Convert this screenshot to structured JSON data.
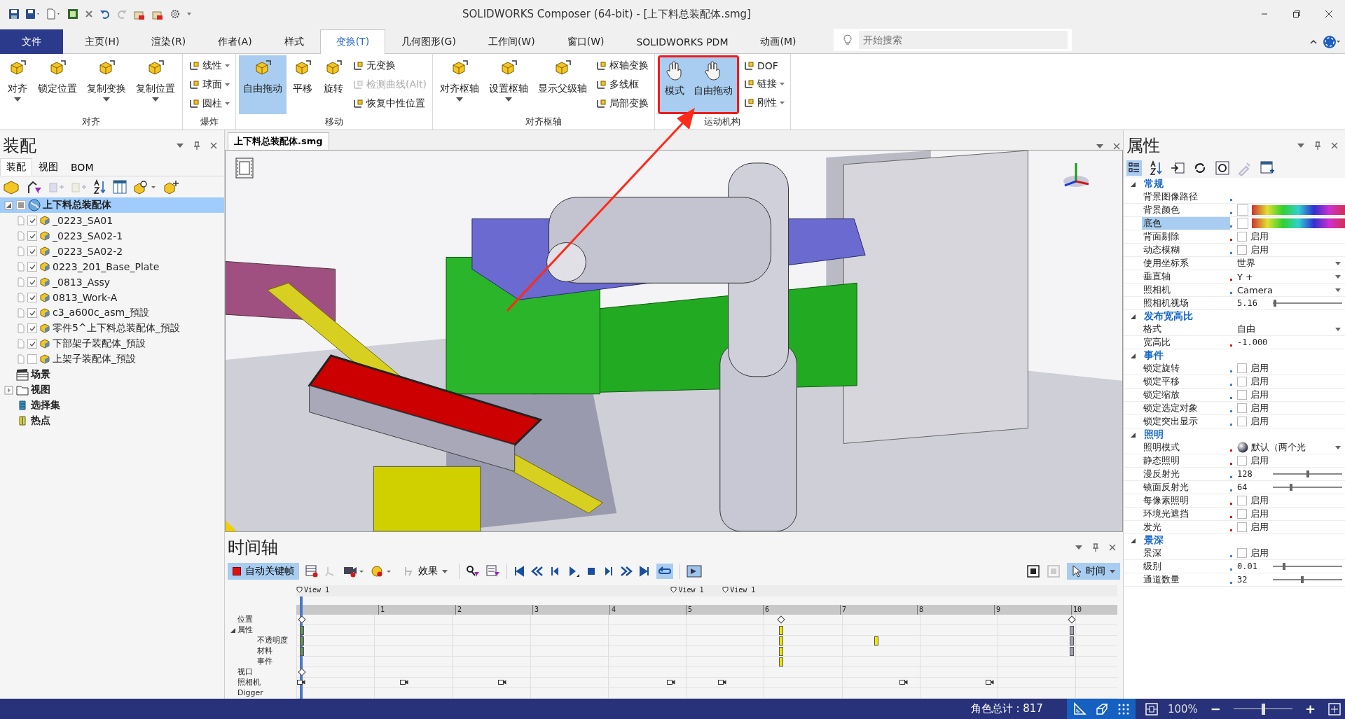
{
  "window": {
    "title": "SOLIDWORKS Composer (64-bit) - [上下料总装配体.smg]"
  },
  "menu_tabs": [
    {
      "label": "文件",
      "kind": "file",
      "selected": false
    },
    {
      "label": "主页(H)",
      "kind": "tab",
      "selected": false
    },
    {
      "label": "渲染(R)",
      "kind": "tab",
      "selected": false
    },
    {
      "label": "作者(A)",
      "kind": "tab",
      "selected": false
    },
    {
      "label": "样式",
      "kind": "tab",
      "selected": false
    },
    {
      "label": "变换(T)",
      "kind": "tab",
      "selected": true
    },
    {
      "label": "几何图形(G)",
      "kind": "tab",
      "selected": false
    },
    {
      "label": "工作间(W)",
      "kind": "tab",
      "selected": false
    },
    {
      "label": "窗口(W)",
      "kind": "tab",
      "selected": false
    },
    {
      "label": "SOLIDWORKS PDM",
      "kind": "tab",
      "selected": false
    },
    {
      "label": "动画(M)",
      "kind": "tab",
      "selected": false
    }
  ],
  "search": {
    "placeholder": "开始搜索"
  },
  "ribbon": {
    "groups": [
      {
        "title": "对齐",
        "columns": [
          {
            "kind": "large",
            "label": "对齐",
            "dropdown": true,
            "selected": false
          },
          {
            "kind": "large",
            "label": "锁定位置",
            "dropdown": false,
            "selected": false
          },
          {
            "kind": "large",
            "label": "复制变换",
            "dropdown": true,
            "selected": false
          },
          {
            "kind": "large",
            "label": "复制位置",
            "dropdown": true,
            "selected": false
          }
        ]
      },
      {
        "title": "爆炸",
        "columns": [
          {
            "kind": "stack",
            "items": [
              {
                "label": "线性",
                "dropdown": true,
                "disabled": false
              },
              {
                "label": "球面",
                "dropdown": true,
                "disabled": false
              },
              {
                "label": "圆柱",
                "dropdown": true,
                "disabled": false
              }
            ]
          }
        ]
      },
      {
        "title": "移动",
        "columns": [
          {
            "kind": "large",
            "label": "自由拖动",
            "dropdown": false,
            "selected": true
          },
          {
            "kind": "large",
            "label": "平移",
            "dropdown": false,
            "selected": false
          },
          {
            "kind": "large",
            "label": "旋转",
            "dropdown": false,
            "selected": false
          },
          {
            "kind": "stack",
            "items": [
              {
                "label": "无变换",
                "dropdown": false,
                "disabled": false
              },
              {
                "label": "检测曲线(Alt)",
                "dropdown": false,
                "disabled": true
              },
              {
                "label": "恢复中性位置",
                "dropdown": false,
                "disabled": false
              }
            ]
          }
        ]
      },
      {
        "title": "对齐枢轴",
        "columns": [
          {
            "kind": "large",
            "label": "对齐枢轴",
            "dropdown": true,
            "selected": false
          },
          {
            "kind": "large",
            "label": "设置枢轴",
            "dropdown": true,
            "selected": false
          },
          {
            "kind": "large",
            "label": "显示父级轴",
            "dropdown": false,
            "selected": false
          },
          {
            "kind": "stack",
            "items": [
              {
                "label": "枢轴变换",
                "dropdown": false,
                "disabled": false
              },
              {
                "label": "多线框",
                "dropdown": false,
                "disabled": false
              },
              {
                "label": "局部变换",
                "dropdown": false,
                "disabled": false
              }
            ]
          }
        ]
      },
      {
        "title": "运动机构",
        "columns": [
          {
            "kind": "frame",
            "items": [
              {
                "label": "模式",
                "dropdown": false,
                "selected": true
              },
              {
                "label": "自由拖动",
                "dropdown": false,
                "selected": true
              }
            ]
          },
          {
            "kind": "stack",
            "items": [
              {
                "label": "DOF",
                "dropdown": false,
                "disabled": false
              },
              {
                "label": "链接",
                "dropdown": true,
                "disabled": false
              },
              {
                "label": "刚性",
                "dropdown": true,
                "disabled": false
              }
            ]
          }
        ]
      }
    ]
  },
  "assembly_panel": {
    "title": "装配",
    "tabs": [
      {
        "label": "装配",
        "selected": true
      },
      {
        "label": "视图",
        "selected": false
      },
      {
        "label": "BOM",
        "selected": false
      }
    ],
    "tree": [
      {
        "label": "上下料总装配体",
        "kind": "assembly",
        "selected": true,
        "expanded": true,
        "partial": true,
        "children": [
          {
            "label": "_0223_SA01",
            "checked": true,
            "selected": false
          },
          {
            "label": "_0223_SA02-1",
            "checked": true,
            "selected": false
          },
          {
            "label": "_0223_SA02-2",
            "checked": true,
            "selected": false
          },
          {
            "label": "0223_201_Base_Plate",
            "checked": true,
            "selected": false
          },
          {
            "label": "_0813_Assy",
            "checked": true,
            "selected": false
          },
          {
            "label": "0813_Work-A",
            "checked": true,
            "selected": false
          },
          {
            "label": "c3_a600c_asm_預設",
            "checked": true,
            "selected": false
          },
          {
            "label": "零件5^上下料总装配体_預設",
            "checked": true,
            "selected": false
          },
          {
            "label": "下部架子装配体_預設",
            "checked": true,
            "selected": false
          },
          {
            "label": "上架子装配体_預設",
            "checked": false,
            "selected": false
          }
        ]
      },
      {
        "label": "场景",
        "kind": "scene",
        "selected": false
      },
      {
        "label": "视图",
        "kind": "folder",
        "selected": false
      },
      {
        "label": "选择集",
        "kind": "selection",
        "selected": false
      },
      {
        "label": "热点",
        "kind": "hotspot",
        "selected": false
      }
    ]
  },
  "document_tab": {
    "label": "上下料总装配体.smg"
  },
  "timeline": {
    "title": "时间轴",
    "autokey": {
      "label": "自动关键帧",
      "selected": true
    },
    "effects": {
      "label": "效果"
    },
    "loop": {
      "selected": true
    },
    "mode": {
      "label": "时间",
      "selected": true
    },
    "view_markers": [
      {
        "label": "View 1",
        "level": 0
      },
      {
        "label": "View 1",
        "level": 0.456
      },
      {
        "label": "View 1",
        "level": 0.519
      }
    ],
    "ticks": [
      {
        "label": "1",
        "level": 0.095
      },
      {
        "label": "2",
        "level": 0.19
      },
      {
        "label": "3",
        "level": 0.285
      },
      {
        "label": "4",
        "level": 0.38
      },
      {
        "label": "5",
        "level": 0.474
      },
      {
        "label": "6",
        "level": 0.569
      },
      {
        "label": "7",
        "level": 0.664
      },
      {
        "label": "8",
        "level": 0.759
      },
      {
        "label": "9",
        "level": 0.854
      },
      {
        "label": "10",
        "level": 0.949
      }
    ],
    "playhead": {
      "level": 0
    },
    "tracks": [
      {
        "label": "位置",
        "keys": [
          {
            "kind": "diamond",
            "level": 0
          },
          {
            "kind": "diamond",
            "level": 0.591
          },
          {
            "kind": "diamond",
            "level": 0.949
          }
        ]
      },
      {
        "label": "属性",
        "expanded": true,
        "keys": [
          {
            "kind": "bar",
            "color": "#5f9360",
            "level": 0
          },
          {
            "kind": "bar",
            "color": "#f2e600",
            "level": 0.591
          },
          {
            "kind": "bar",
            "color": "#a0a4b0",
            "level": 0.949
          }
        ],
        "children": [
          {
            "label": "不透明度",
            "keys": [
              {
                "kind": "bar",
                "color": "#5f9360",
                "level": 0
              },
              {
                "kind": "bar",
                "color": "#f2e600",
                "level": 0.591
              },
              {
                "kind": "bar",
                "color": "#f2e600",
                "level": 0.708
              },
              {
                "kind": "bar",
                "color": "#a0a4b0",
                "level": 0.949
              }
            ]
          },
          {
            "label": "材料",
            "keys": [
              {
                "kind": "bar",
                "color": "#5f9360",
                "level": 0
              },
              {
                "kind": "bar",
                "color": "#f2e600",
                "level": 0.591
              },
              {
                "kind": "bar",
                "color": "#a0a4b0",
                "level": 0.949
              }
            ]
          },
          {
            "label": "事件",
            "keys": [
              {
                "kind": "bar",
                "color": "#f2e600",
                "level": 0.591
              }
            ]
          }
        ]
      },
      {
        "label": "视口",
        "keys": [
          {
            "kind": "diamond",
            "level": 0
          }
        ]
      },
      {
        "label": "照相机",
        "keys": [
          {
            "kind": "camera",
            "level": 0
          },
          {
            "kind": "camera",
            "level": 0.127
          },
          {
            "kind": "camera",
            "level": 0.248
          },
          {
            "kind": "camera",
            "level": 0.456
          },
          {
            "kind": "camera",
            "level": 0.519
          },
          {
            "kind": "camera",
            "level": 0.743
          },
          {
            "kind": "camera",
            "level": 0.849
          }
        ]
      },
      {
        "label": "Digger"
      }
    ]
  },
  "properties": {
    "title": "属性",
    "sections": [
      {
        "title": "常规",
        "expanded": true,
        "rows": [
          {
            "name": "背景图像路径",
            "kind": "empty",
            "color": "#3c7fd0",
            "selected": false
          },
          {
            "name": "背景颜色",
            "kind": "color",
            "color": "#3c7fd0",
            "selected": false
          },
          {
            "name": "底色",
            "kind": "color",
            "color": "#3c7fd0",
            "selected": true
          },
          {
            "name": "背面剔除",
            "kind": "checkbox",
            "label": "启用",
            "checked": false,
            "color": "#e01010",
            "selected": false
          },
          {
            "name": "动态模糊",
            "kind": "checkbox",
            "label": "启用",
            "checked": false,
            "color": "#3c7fd0",
            "selected": false
          },
          {
            "name": "使用坐标系",
            "kind": "select",
            "value": "世界",
            "selected": false
          },
          {
            "name": "垂直轴",
            "kind": "select",
            "value": "Y +",
            "color": "#e01010",
            "selected": false
          },
          {
            "name": "照相机",
            "kind": "select",
            "value": "Camera",
            "color": "#3c7fd0",
            "selected": false
          },
          {
            "name": "照相机视场",
            "kind": "slider",
            "value": "5.16",
            "level": 0.03,
            "selected": false
          }
        ]
      },
      {
        "title": "发布宽高比",
        "expanded": true,
        "rows": [
          {
            "name": "格式",
            "kind": "select",
            "value": "自由",
            "selected": false
          },
          {
            "name": "宽高比",
            "kind": "text",
            "value": "-1.000",
            "color": "#e01010",
            "selected": false
          }
        ]
      },
      {
        "title": "事件",
        "expanded": true,
        "rows": [
          {
            "name": "锁定旋转",
            "kind": "checkbox",
            "label": "启用",
            "checked": false,
            "color": "#3c7fd0",
            "selected": false
          },
          {
            "name": "锁定平移",
            "kind": "checkbox",
            "label": "启用",
            "checked": false,
            "color": "#3c7fd0",
            "selected": false
          },
          {
            "name": "锁定缩放",
            "kind": "checkbox",
            "label": "启用",
            "checked": false,
            "color": "#3c7fd0",
            "selected": false
          },
          {
            "name": "锁定选定对象",
            "kind": "checkbox",
            "label": "启用",
            "checked": false,
            "color": "#3c7fd0",
            "selected": false
          },
          {
            "name": "锁定突出显示",
            "kind": "checkbox",
            "label": "启用",
            "checked": false,
            "color": "#3c7fd0",
            "selected": false
          }
        ]
      },
      {
        "title": "照明",
        "expanded": true,
        "rows": [
          {
            "name": "照明模式",
            "kind": "lighting",
            "value": "默认（两个光",
            "color": "#e01010",
            "selected": false
          },
          {
            "name": "静态照明",
            "kind": "checkbox",
            "label": "启用",
            "checked": false,
            "color": "#e01010",
            "selected": false
          },
          {
            "name": "漫反射光",
            "kind": "slider",
            "value": "128",
            "level": 0.5,
            "color": "#3c7fd0",
            "selected": false
          },
          {
            "name": "镜面反射光",
            "kind": "slider",
            "value": "64",
            "level": 0.26,
            "color": "#3c7fd0",
            "selected": false
          },
          {
            "name": "每像素照明",
            "kind": "checkbox",
            "label": "启用",
            "checked": false,
            "color": "#e01010",
            "selected": false
          },
          {
            "name": "环境光遮挡",
            "kind": "checkbox",
            "label": "启用",
            "checked": false,
            "color": "#e01010",
            "selected": false
          },
          {
            "name": "发光",
            "kind": "checkbox",
            "label": "启用",
            "checked": false,
            "color": "#e01010",
            "selected": false
          }
        ]
      },
      {
        "title": "景深",
        "expanded": true,
        "rows": [
          {
            "name": "景深",
            "kind": "checkbox",
            "label": "启用",
            "checked": false,
            "color": "#3c7fd0",
            "selected": false
          },
          {
            "name": "级别",
            "kind": "slider",
            "value": "0.01",
            "level": 0.16,
            "color": "#3c7fd0",
            "selected": false
          },
          {
            "name": "通道数量",
            "kind": "slider",
            "value": "32",
            "level": 0.42,
            "color": "#3c7fd0",
            "selected": false
          }
        ]
      }
    ]
  },
  "status_bar": {
    "actor_total": "角色总计 : 817",
    "zoom": "100%",
    "zoom_out": "−",
    "zoom_in": "+",
    "zoom_slider": {
      "level": 0.5
    }
  }
}
